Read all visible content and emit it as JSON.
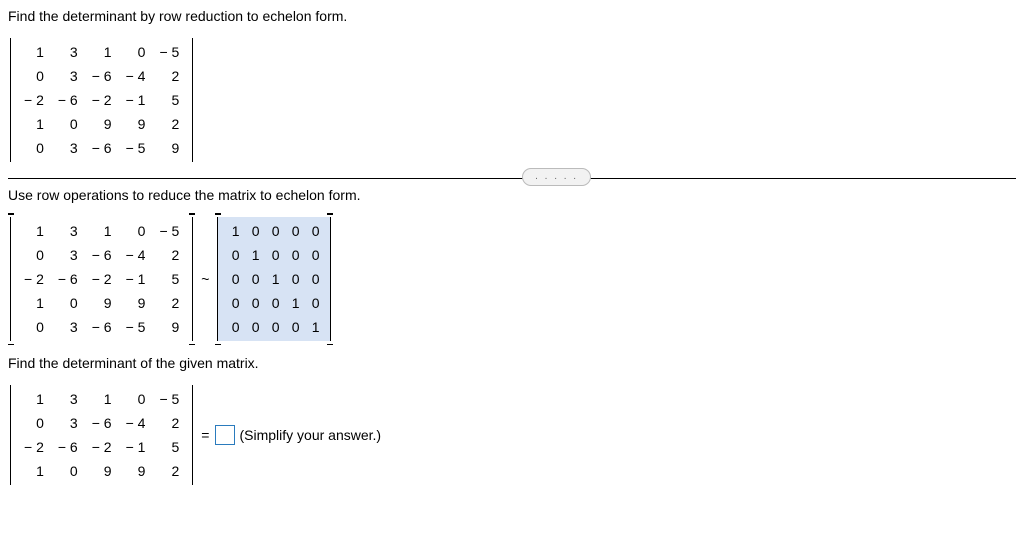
{
  "q_title": "Find the determinant by row reduction to echelon form.",
  "matrix_A": [
    [
      "1",
      "3",
      "1",
      "0",
      "− 5"
    ],
    [
      "0",
      "3",
      "− 6",
      "− 4",
      "2"
    ],
    [
      "− 2",
      "− 6",
      "− 2",
      "− 1",
      "5"
    ],
    [
      "1",
      "0",
      "9",
      "9",
      "2"
    ],
    [
      "0",
      "3",
      "− 6",
      "− 5",
      "9"
    ]
  ],
  "step1_text": "Use row operations to reduce the matrix to echelon form.",
  "tilde": "~",
  "identity5": [
    [
      "1",
      "0",
      "0",
      "0",
      "0"
    ],
    [
      "0",
      "1",
      "0",
      "0",
      "0"
    ],
    [
      "0",
      "0",
      "1",
      "0",
      "0"
    ],
    [
      "0",
      "0",
      "0",
      "1",
      "0"
    ],
    [
      "0",
      "0",
      "0",
      "0",
      "1"
    ]
  ],
  "step2_text": "Find the determinant of the given matrix.",
  "matrix_B": [
    [
      "1",
      "3",
      "1",
      "0",
      "− 5"
    ],
    [
      "0",
      "3",
      "− 6",
      "− 4",
      "2"
    ],
    [
      "− 2",
      "− 6",
      "− 2",
      "− 1",
      "5"
    ],
    [
      "1",
      "0",
      "9",
      "9",
      "2"
    ]
  ],
  "equals": "=",
  "hint": "(Simplify your answer.)",
  "answer": "",
  "pill": ". . . . ."
}
